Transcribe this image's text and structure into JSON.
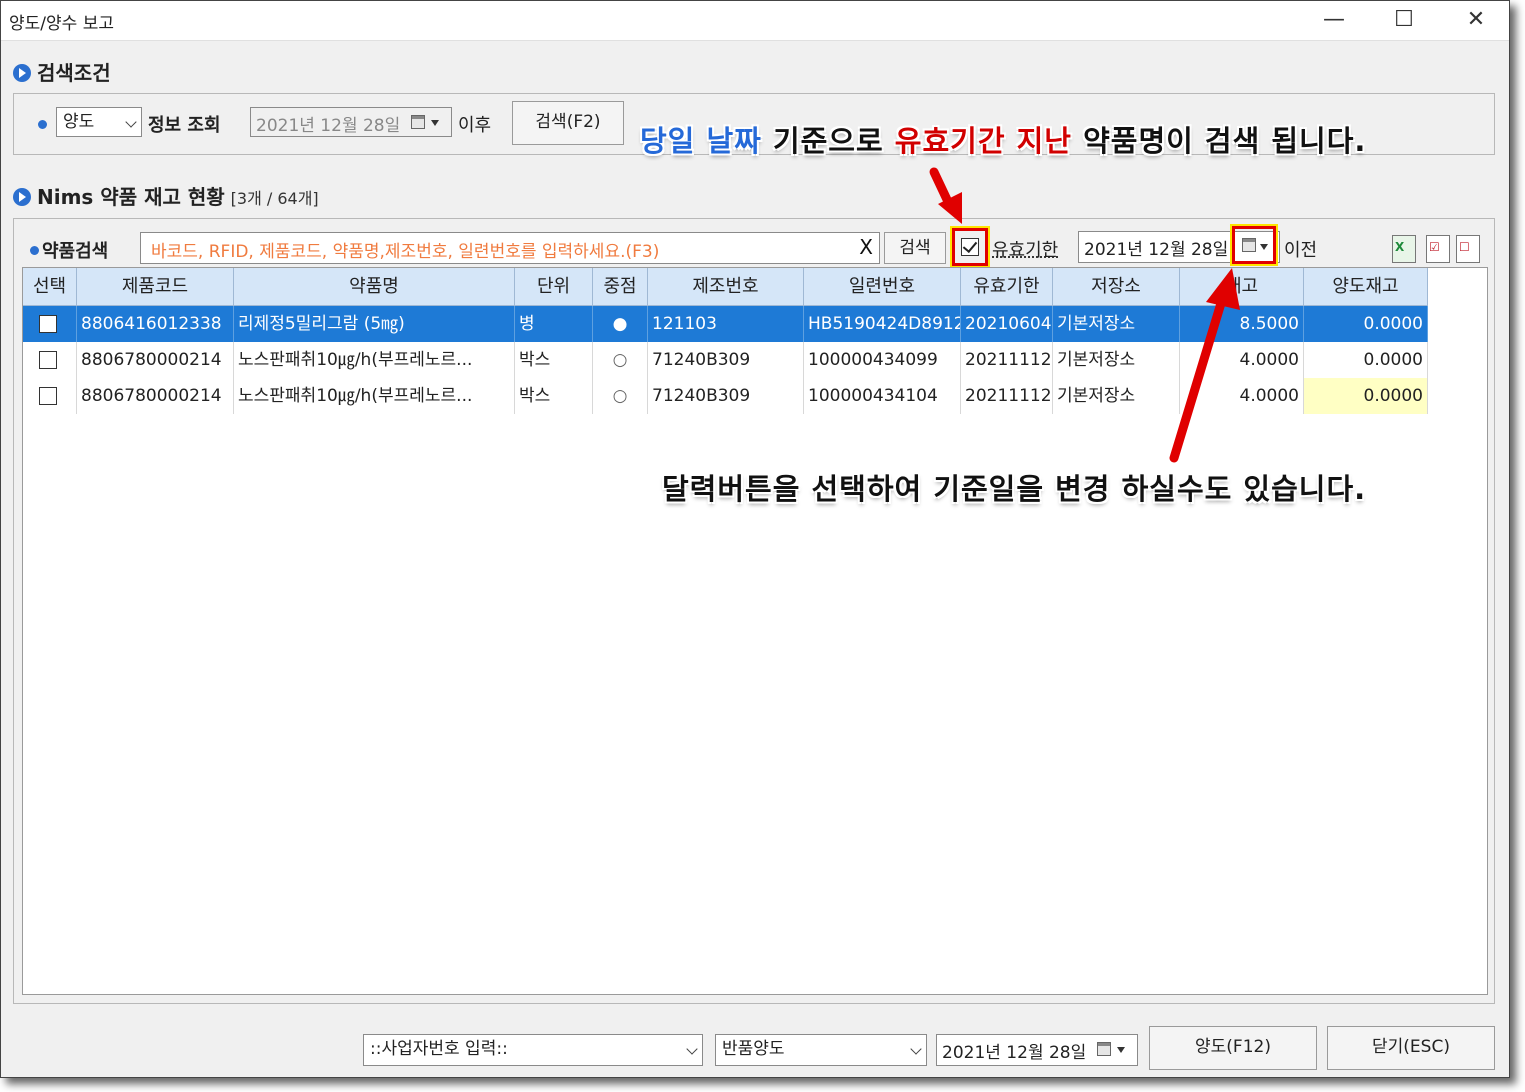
{
  "window": {
    "title": "양도/양수 보고"
  },
  "search_section": {
    "title": "검색조건",
    "type_select": "양도",
    "info_label": "정보 조회",
    "date": "2021년 12월 28일",
    "after_label": "이후",
    "search_button": "검색(F2)"
  },
  "inventory_section": {
    "title": "Nims 약품 재고 현황",
    "count": "[3개 / 64개]",
    "drug_search_label": "약품검색",
    "search_placeholder": "바코드, RFID, 제품코드, 약품명,제조번호, 일련번호를 입력하세요.(F3)",
    "search_button": "검색",
    "expiry_checked": true,
    "expiry_label": "유효기한",
    "expiry_date": "2021년 12월 28일",
    "before_label": "이전"
  },
  "table": {
    "columns": [
      "선택",
      "제품코드",
      "약품명",
      "단위",
      "중점",
      "제조번호",
      "일련번호",
      "유효기한",
      "저장소",
      "재고",
      "양도재고"
    ],
    "rows": [
      {
        "selected": true,
        "code": "8806416012338",
        "name": "리제정5밀리그람 (5㎎)",
        "unit": "병",
        "focus": "●",
        "mfg": "121103",
        "serial": "HB5190424D8912",
        "expiry": "20210604",
        "storage": "기본저장소",
        "stock": "8.5000",
        "transfer": "0.0000"
      },
      {
        "selected": false,
        "code": "8806780000214",
        "name": "노스판패취10㎍/h(부프레노르...",
        "unit": "박스",
        "focus": "○",
        "mfg": "71240B309",
        "serial": "100000434099",
        "expiry": "20211112",
        "storage": "기본저장소",
        "stock": "4.0000",
        "transfer": "0.0000"
      },
      {
        "selected": false,
        "code": "8806780000214",
        "name": "노스판패취10㎍/h(부프레노르...",
        "unit": "박스",
        "focus": "○",
        "mfg": "71240B309",
        "serial": "100000434104",
        "expiry": "20211112",
        "storage": "기본저장소",
        "stock": "4.0000",
        "transfer": "0.0000"
      }
    ]
  },
  "annotations": {
    "top_blue": "당일 날짜",
    "top_mid1": "기준으로",
    "top_red": "유효기간 지난",
    "top_end": "약품명이 검색 됩니다.",
    "bottom": "달력버튼을 선택하여 기준일을 변경 하실수도 있습니다."
  },
  "footer": {
    "business_select": "::사업자번호 입력::",
    "return_select": "반품양도",
    "date": "2021년 12월 28일",
    "transfer_button": "양도(F12)",
    "close_button": "닫기(ESC)"
  },
  "colors": {
    "accent": "#2b6fcf",
    "selected_row": "#1e7ad6",
    "header": "#d5e6f8",
    "highlight": "#e00000"
  }
}
